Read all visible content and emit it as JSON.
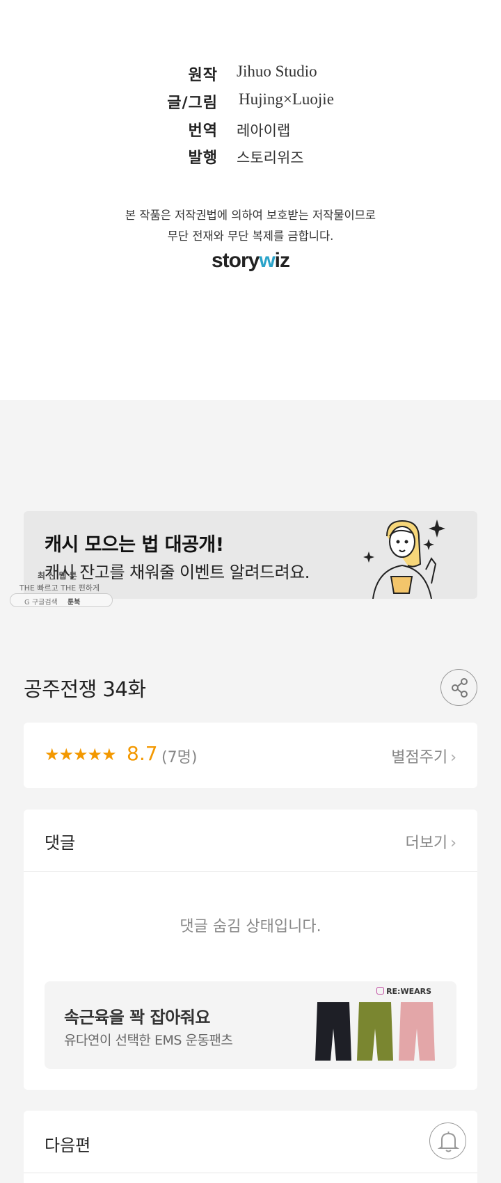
{
  "credits": [
    {
      "label": "원작",
      "value": "Jihuo Studio"
    },
    {
      "label": "글/그림",
      "value": "Hujing×Luojie"
    },
    {
      "label": "번역",
      "value": "레아이랩"
    },
    {
      "label": "발행",
      "value": "스토리위즈"
    }
  ],
  "copyright": {
    "line1": "본 작품은 저작권법에 의하여 보호받는 저작물이므로",
    "line2": "무단 전재와 무단 복제를 금합니다."
  },
  "logo": {
    "pre": "story",
    "accent": "w",
    "post": "iz"
  },
  "banner": {
    "title": "캐시 모으는 법 대공개!",
    "subtitle": "캐시 잔고를 채워줄 이벤트 알려드려요."
  },
  "watermark": {
    "line1": "최 신 웹 툰",
    "line2": "THE 빠르고 THE 편하게",
    "google": "G 구글검색",
    "toonbook": "툰북"
  },
  "episode": {
    "title": "공주전쟁 34화"
  },
  "rating": {
    "stars": "★★★★★",
    "value": "8.7",
    "count": "(7명)",
    "rate_link": "별점주기",
    "score_out_of_10": 8.7
  },
  "comments": {
    "heading": "댓글",
    "more": "더보기",
    "hidden_message": "댓글 숨김 상태입니다."
  },
  "ad": {
    "title": "속근육을 꽉 잡아줘요",
    "subtitle": "유다연이 선택한 EMS 운동팬츠",
    "brand": "RE:WEARS",
    "colors": [
      "#1e1f26",
      "#7a8630",
      "#e3a6a8"
    ]
  },
  "next": {
    "label": "다음편"
  },
  "icons": {
    "share": "share-icon",
    "bell": "bell-icon",
    "chevron": "chevron-right-icon"
  }
}
